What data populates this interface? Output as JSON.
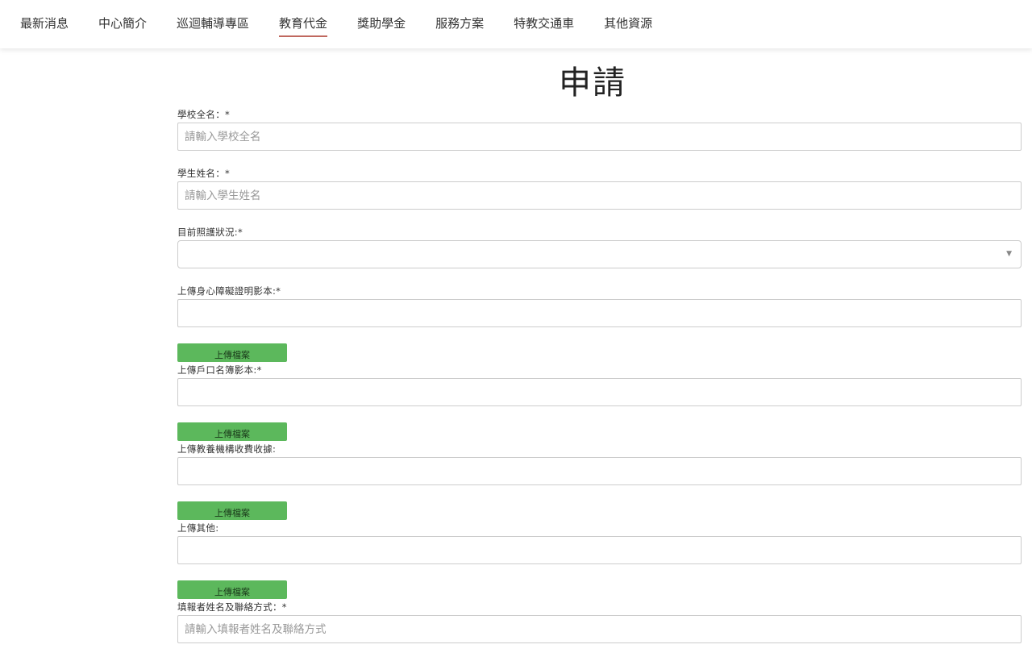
{
  "nav": {
    "items": [
      {
        "label": "最新消息"
      },
      {
        "label": "中心簡介"
      },
      {
        "label": "巡迴輔導專區"
      },
      {
        "label": "教育代金"
      },
      {
        "label": "獎助學金"
      },
      {
        "label": "服務方案"
      },
      {
        "label": "特教交通車"
      },
      {
        "label": "其他資源"
      }
    ],
    "active_index": 3,
    "active_underline_color": "#c0685f"
  },
  "page": {
    "title": "申請"
  },
  "form": {
    "school_name": {
      "label": "學校全名：*",
      "placeholder": "請輸入學校全名",
      "value": ""
    },
    "student_name": {
      "label": "學生姓名：*",
      "placeholder": "請輸入學生姓名",
      "value": ""
    },
    "care_status": {
      "label": "目前照護狀況:*",
      "selected": ""
    },
    "disability_proof": {
      "label": "上傳身心障礙證明影本:*",
      "button_label": "上傳檔案"
    },
    "household_register": {
      "label": "上傳戶口名簿影本:*",
      "button_label": "上傳檔案"
    },
    "institution_receipt": {
      "label": "上傳教養機構收費收據:",
      "button_label": "上傳檔案"
    },
    "other_upload": {
      "label": "上傳其他:",
      "button_label": "上傳檔案"
    },
    "reporter_contact": {
      "label": "填報者姓名及聯絡方式：*",
      "placeholder": "請輸入填報者姓名及聯絡方式",
      "value": ""
    }
  },
  "colors": {
    "upload_button_bg": "#5cb85c",
    "field_border": "#cccccc"
  },
  "icons": {
    "select_arrow": "caret-down-icon"
  }
}
